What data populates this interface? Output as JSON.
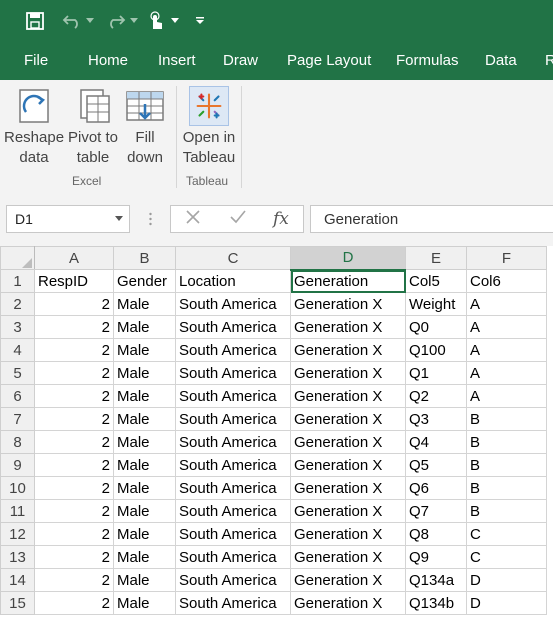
{
  "quick_access": {
    "icons": [
      "save-icon",
      "undo-icon",
      "undo-dropdown-icon",
      "redo-icon",
      "redo-dropdown-icon",
      "touch-mode-icon",
      "touch-dropdown-icon",
      "customize-qat-icon"
    ]
  },
  "menu": [
    "File",
    "Home",
    "Insert",
    "Draw",
    "Page Layout",
    "Formulas",
    "Data",
    "R"
  ],
  "ribbon": {
    "excel_group": {
      "label": "Excel",
      "buttons": [
        {
          "line1": "Reshape",
          "line2": "data",
          "icon": "reshape-data-icon"
        },
        {
          "line1": "Pivot to",
          "line2": "table",
          "icon": "pivot-to-table-icon"
        },
        {
          "line1": "Fill",
          "line2": "down",
          "icon": "fill-down-icon"
        }
      ]
    },
    "tableau_group": {
      "label": "Tableau",
      "buttons": [
        {
          "line1": "Open in",
          "line2": "Tableau",
          "icon": "tableau-icon"
        }
      ]
    }
  },
  "formula_bar": {
    "name_box": "D1",
    "fx_label": "fx",
    "content": "Generation"
  },
  "sheet": {
    "columns": [
      "A",
      "B",
      "C",
      "D",
      "E",
      "F"
    ],
    "selected_column": "D",
    "rows": [
      {
        "n": "1",
        "cells": [
          "RespID",
          "Gender",
          "Location",
          "Generation",
          "Col5",
          "Col6"
        ]
      },
      {
        "n": "2",
        "cells": [
          "2",
          "Male",
          "South America",
          "Generation X",
          "Weight",
          "A"
        ]
      },
      {
        "n": "3",
        "cells": [
          "2",
          "Male",
          "South America",
          "Generation X",
          "Q0",
          "A"
        ]
      },
      {
        "n": "4",
        "cells": [
          "2",
          "Male",
          "South America",
          "Generation X",
          "Q100",
          "A"
        ]
      },
      {
        "n": "5",
        "cells": [
          "2",
          "Male",
          "South America",
          "Generation X",
          "Q1",
          "A"
        ]
      },
      {
        "n": "6",
        "cells": [
          "2",
          "Male",
          "South America",
          "Generation X",
          "Q2",
          "A"
        ]
      },
      {
        "n": "7",
        "cells": [
          "2",
          "Male",
          "South America",
          "Generation X",
          "Q3",
          "B"
        ]
      },
      {
        "n": "8",
        "cells": [
          "2",
          "Male",
          "South America",
          "Generation X",
          "Q4",
          "B"
        ]
      },
      {
        "n": "9",
        "cells": [
          "2",
          "Male",
          "South America",
          "Generation X",
          "Q5",
          "B"
        ]
      },
      {
        "n": "10",
        "cells": [
          "2",
          "Male",
          "South America",
          "Generation X",
          "Q6",
          "B"
        ]
      },
      {
        "n": "11",
        "cells": [
          "2",
          "Male",
          "South America",
          "Generation X",
          "Q7",
          "B"
        ]
      },
      {
        "n": "12",
        "cells": [
          "2",
          "Male",
          "South America",
          "Generation X",
          "Q8",
          "C"
        ]
      },
      {
        "n": "13",
        "cells": [
          "2",
          "Male",
          "South America",
          "Generation X",
          "Q9",
          "C"
        ]
      },
      {
        "n": "14",
        "cells": [
          "2",
          "Male",
          "South America",
          "Generation X",
          "Q134a",
          "D"
        ]
      },
      {
        "n": "15",
        "cells": [
          "2",
          "Male",
          "South America",
          "Generation X",
          "Q134b",
          "D"
        ]
      }
    ]
  },
  "colors": {
    "excel_green": "#217346",
    "ribbon_bg": "#f3f3f3",
    "tableau_blue": "#1f77b4",
    "tableau_orange": "#e8762d"
  }
}
